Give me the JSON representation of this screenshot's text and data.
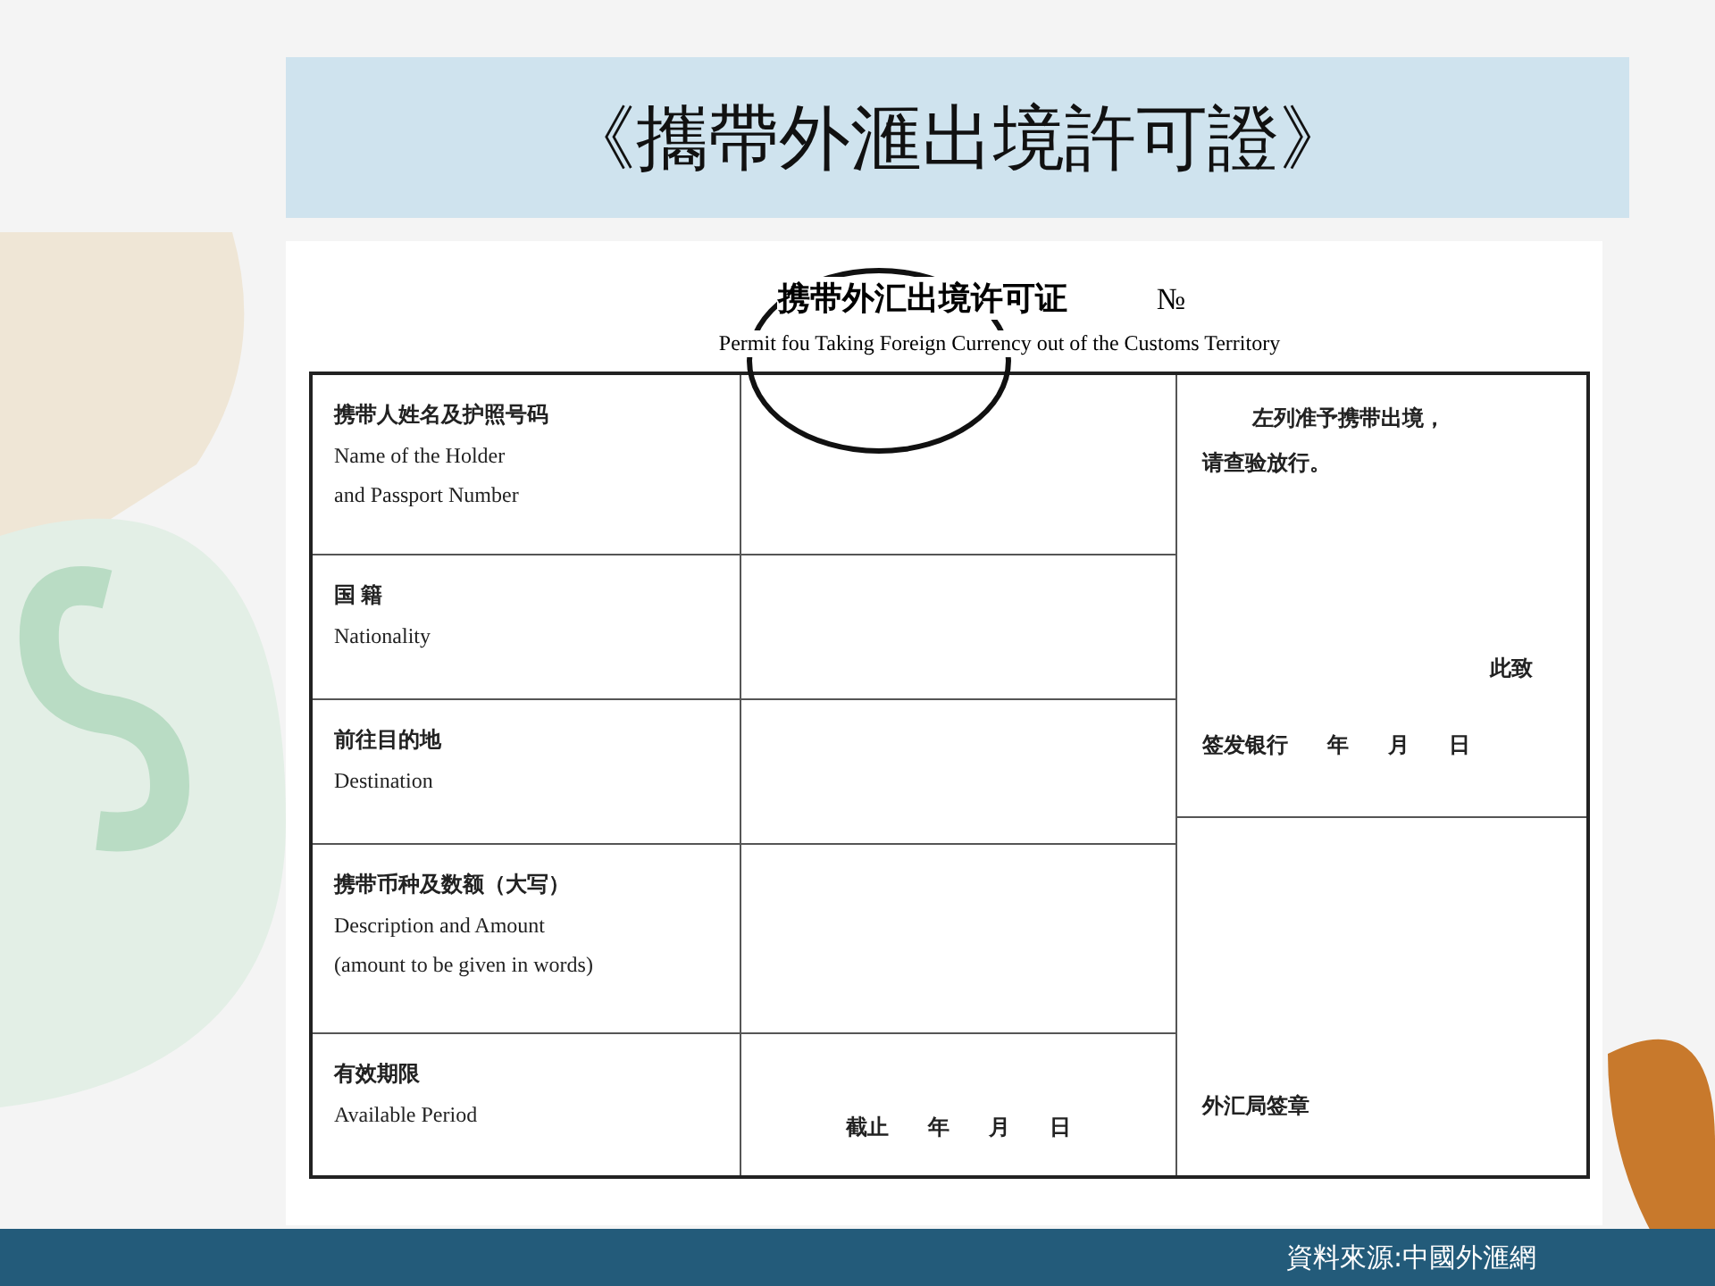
{
  "slide_title": "《攜帶外滙出境許可證》",
  "document": {
    "title": "携带外汇出境许可证",
    "number_label": "№",
    "subtitle": "Permit fou Taking Foreign Currency out of the Customs Territory",
    "rows": [
      {
        "label_zh": "携带人姓名及护照号码",
        "label_en": [
          "Name of the Holder",
          "and Passport Number"
        ]
      },
      {
        "label_zh": "国 籍",
        "label_en": [
          "Nationality"
        ]
      },
      {
        "label_zh": "前往目的地",
        "label_en": [
          "Destination"
        ]
      },
      {
        "label_zh": "携带币种及数额（大写）",
        "label_en": [
          "Description and Amount",
          "(amount to be given in words)"
        ]
      },
      {
        "label_zh": "有效期限",
        "label_en": [
          "Available Period"
        ],
        "value": [
          "截止",
          "年",
          "月",
          "日"
        ]
      }
    ],
    "approval": {
      "lines": [
        "左列准予携带出境，",
        "请查验放行。"
      ],
      "closing": "此致",
      "issuer": "签发银行",
      "date": [
        "年",
        "月",
        "日"
      ]
    },
    "signature": "外汇局签章"
  },
  "source": "資料來源:中國外滙網"
}
